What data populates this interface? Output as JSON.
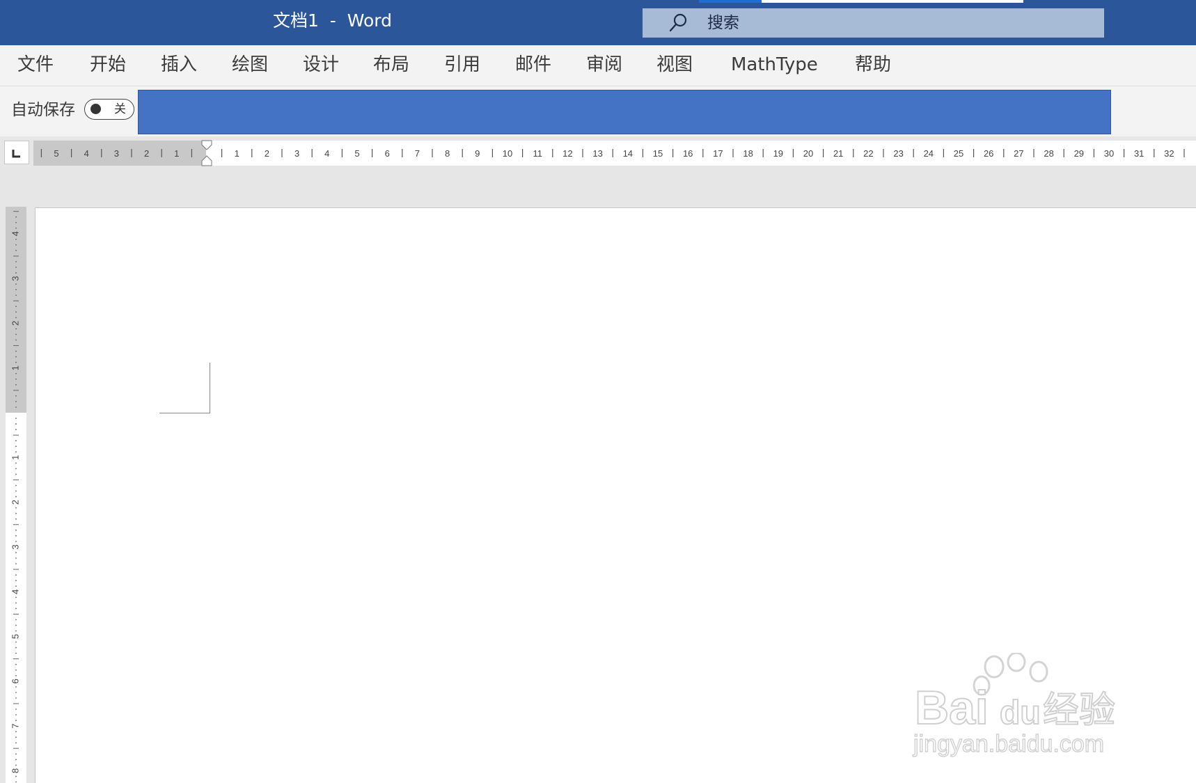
{
  "window": {
    "title": "文档1  -  Word",
    "accent_color": "#2b579a"
  },
  "search": {
    "label": "搜索",
    "icon": "search-icon"
  },
  "menu": {
    "tabs": [
      "文件",
      "开始",
      "插入",
      "绘图",
      "设计",
      "布局",
      "引用",
      "邮件",
      "审阅",
      "视图",
      "MathType",
      "帮助"
    ]
  },
  "ribbon": {
    "autosave_label": "自动保存",
    "autosave_state": "关",
    "panel_color": "#4472c4"
  },
  "ruler": {
    "horizontal_left_labels": [
      "5",
      "4",
      "3",
      "2",
      "1"
    ],
    "horizontal_right_labels": [
      "1",
      "2",
      "3",
      "4",
      "5",
      "6",
      "7",
      "8",
      "9",
      "10",
      "11",
      "12",
      "13",
      "14",
      "15",
      "16",
      "17",
      "18",
      "19",
      "20",
      "21",
      "22",
      "23",
      "24",
      "25",
      "26",
      "27",
      "28",
      "29",
      "30",
      "31",
      "32"
    ],
    "vertical_top_labels": [
      "4",
      "3",
      "2",
      "1"
    ],
    "vertical_bottom_labels": [
      "1",
      "2",
      "3",
      "4",
      "5",
      "6",
      "7",
      "8"
    ]
  },
  "watermark": {
    "brand": "Bai",
    "brand_suffix": "du",
    "product": "经验",
    "url": "jingyan.baidu.com"
  }
}
